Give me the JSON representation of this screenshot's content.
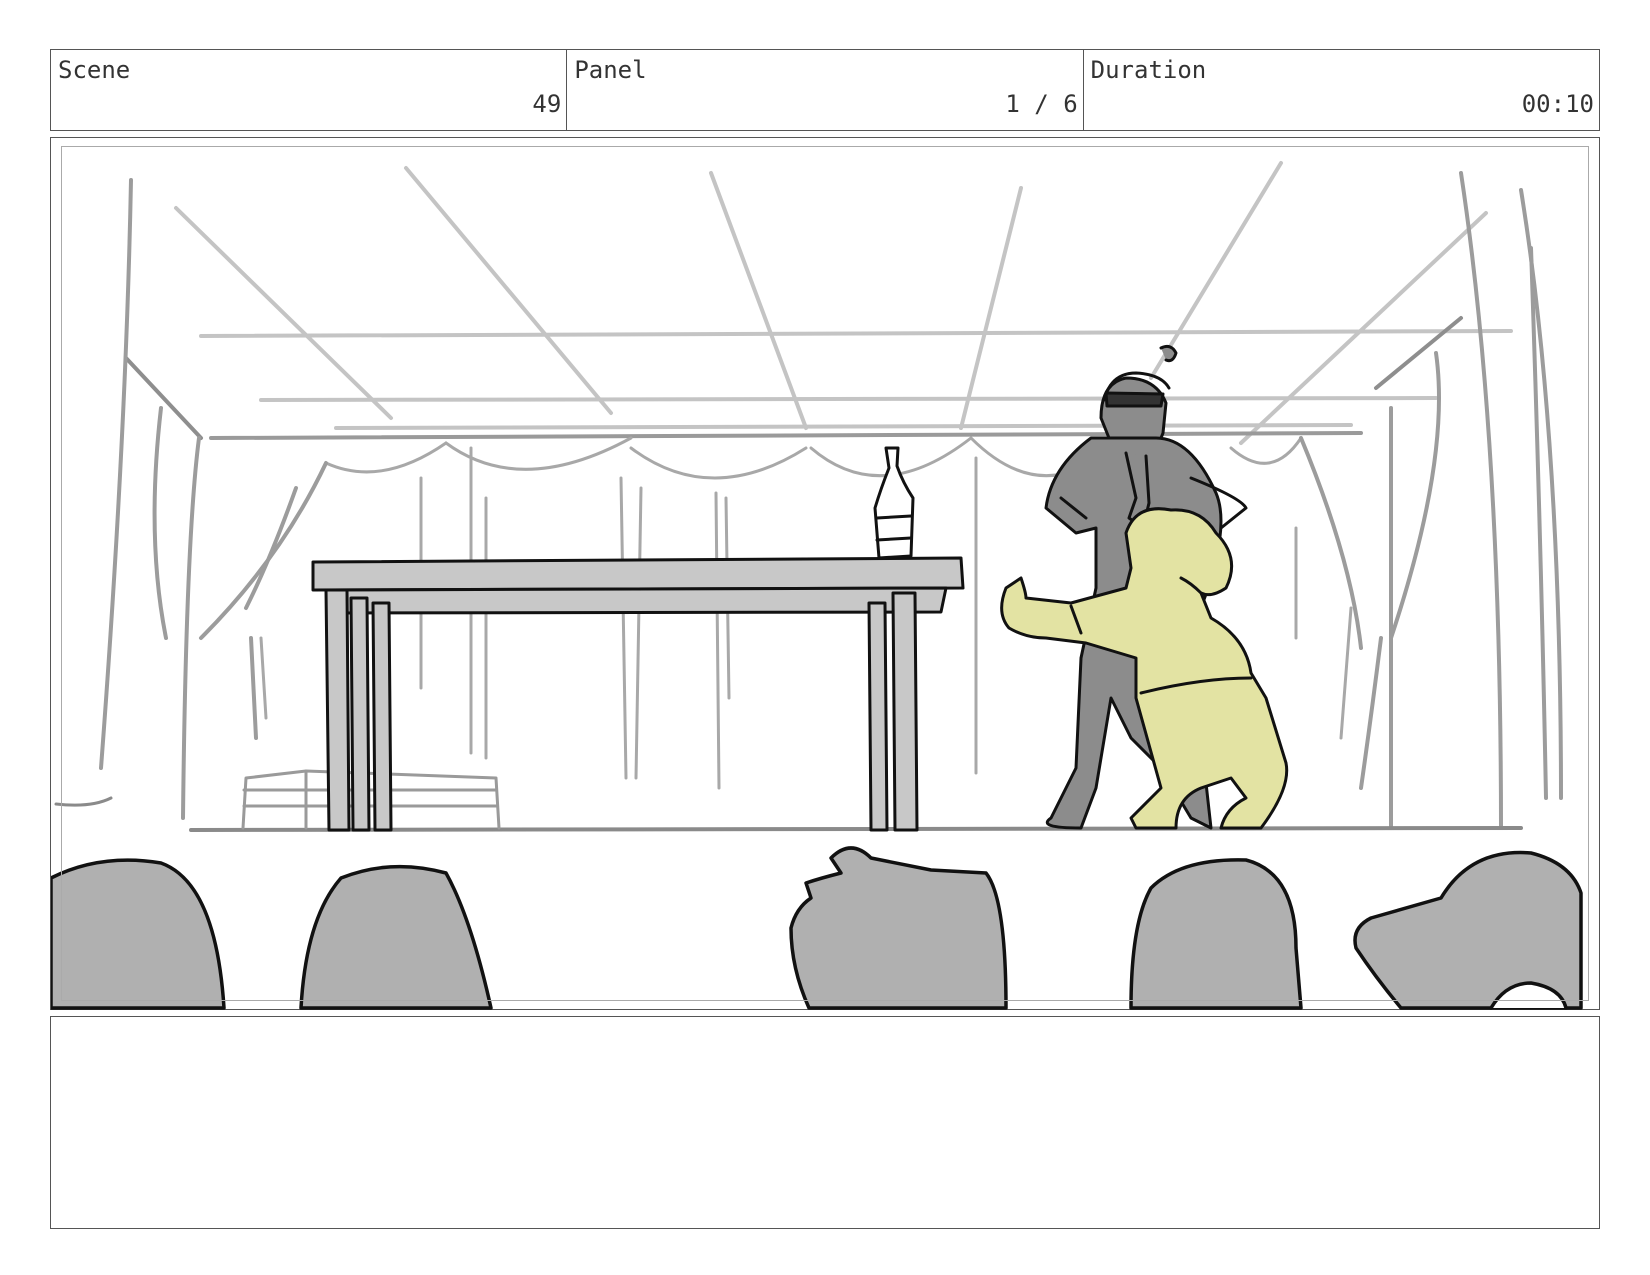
{
  "header": {
    "scene_label": "Scene",
    "scene_value": "49",
    "panel_label": "Panel",
    "panel_value": "1 / 6",
    "duration_label": "Duration",
    "duration_value": "00:10"
  },
  "frame": {
    "description_icon": "storyboard-sketch",
    "colors": {
      "character_highlight": "#e3e3a3",
      "character_gray": "#8c8c8c",
      "audience_gray": "#b0b0b0"
    }
  },
  "notes": {
    "text": ""
  }
}
